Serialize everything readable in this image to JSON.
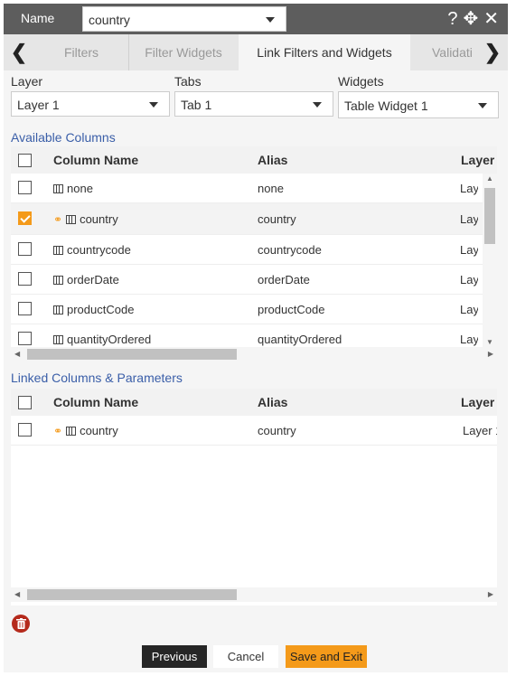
{
  "header": {
    "name_label": "Name",
    "name_value": "country"
  },
  "tabs": [
    {
      "label": "Filters"
    },
    {
      "label": "Filter Widgets"
    },
    {
      "label": "Link Filters and Widgets"
    },
    {
      "label": "Validati"
    }
  ],
  "selectors": {
    "layer": {
      "label": "Layer",
      "value": "Layer 1"
    },
    "tabs": {
      "label": "Tabs",
      "value": "Tab 1"
    },
    "widgets": {
      "label": "Widgets",
      "value": "Table Widget 1"
    }
  },
  "available": {
    "title": "Available Columns",
    "headers": {
      "name": "Column Name",
      "alias": "Alias",
      "layer": "Layer"
    },
    "rows": [
      {
        "name": "none",
        "alias": "none",
        "layer": "Lay",
        "checked": false,
        "linked": false
      },
      {
        "name": "country",
        "alias": "country",
        "layer": "Lay",
        "checked": true,
        "linked": true
      },
      {
        "name": "countrycode",
        "alias": "countrycode",
        "layer": "Lay",
        "checked": false,
        "linked": false
      },
      {
        "name": "orderDate",
        "alias": "orderDate",
        "layer": "Lay",
        "checked": false,
        "linked": false
      },
      {
        "name": "productCode",
        "alias": "productCode",
        "layer": "Lay",
        "checked": false,
        "linked": false
      },
      {
        "name": "quantityOrdered",
        "alias": "quantityOrdered",
        "layer": "Lay",
        "checked": false,
        "linked": false
      }
    ]
  },
  "linked": {
    "title": "Linked Columns & Parameters",
    "headers": {
      "name": "Column Name",
      "alias": "Alias",
      "layer": "Layer"
    },
    "rows": [
      {
        "name": "country",
        "alias": "country",
        "layer": "Layer 1",
        "checked": false,
        "linked": true
      }
    ]
  },
  "buttons": {
    "previous": "Previous",
    "cancel": "Cancel",
    "save_exit": "Save and Exit"
  },
  "colors": {
    "accent": "#f49a1a",
    "header_bg": "#5d5d5d",
    "section_title": "#3a5ea8",
    "delete": "#b52a1c"
  },
  "icons": {
    "help": "question-icon",
    "move": "move-icon",
    "close": "close-icon",
    "column": "column-icon",
    "link": "link-icon",
    "delete": "trash-icon"
  }
}
